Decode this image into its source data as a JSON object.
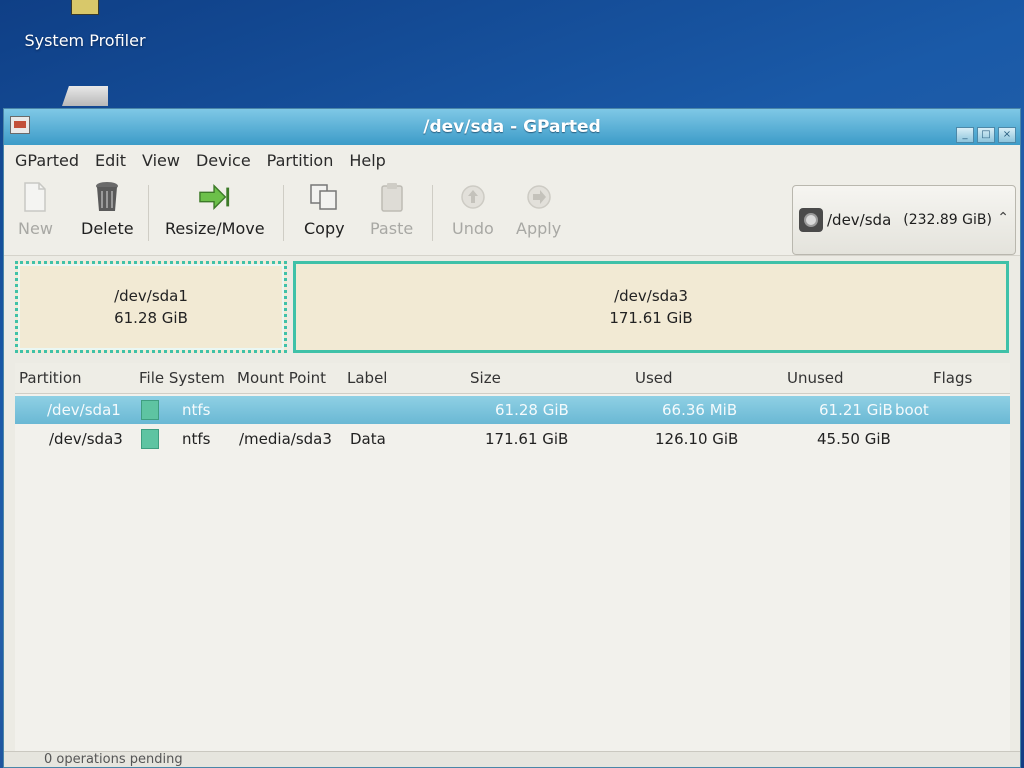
{
  "desktop": {
    "icon_label": "System Profiler"
  },
  "window": {
    "title": "/dev/sda - GParted"
  },
  "menu": [
    "GParted",
    "Edit",
    "View",
    "Device",
    "Partition",
    "Help"
  ],
  "toolbar": {
    "new": "New",
    "delete": "Delete",
    "resize_move": "Resize/Move",
    "copy": "Copy",
    "paste": "Paste",
    "undo": "Undo",
    "apply": "Apply"
  },
  "device_selector": {
    "device": "/dev/sda",
    "size": "(232.89 GiB)"
  },
  "graphic": [
    {
      "name": "/dev/sda1",
      "size": "61.28 GiB"
    },
    {
      "name": "/dev/sda3",
      "size": "171.61 GiB"
    }
  ],
  "table": {
    "headers": {
      "partition": "Partition",
      "file_system": "File System",
      "mount_point": "Mount Point",
      "label": "Label",
      "size": "Size",
      "used": "Used",
      "unused": "Unused",
      "flags": "Flags"
    },
    "rows": [
      {
        "partition": "/dev/sda1",
        "file_system": "ntfs",
        "mount_point": "",
        "label": "",
        "size": "61.28 GiB",
        "used": "66.36 MiB",
        "unused": "61.21 GiB",
        "flags": "boot"
      },
      {
        "partition": "/dev/sda3",
        "file_system": "ntfs",
        "mount_point": "/media/sda3",
        "label": "Data",
        "size": "171.61 GiB",
        "used": "126.10 GiB",
        "unused": "45.50 GiB",
        "flags": ""
      }
    ]
  },
  "status": "0 operations pending",
  "colors": {
    "ntfs": "#5ec4a2",
    "selection": "#7cc4dc"
  }
}
